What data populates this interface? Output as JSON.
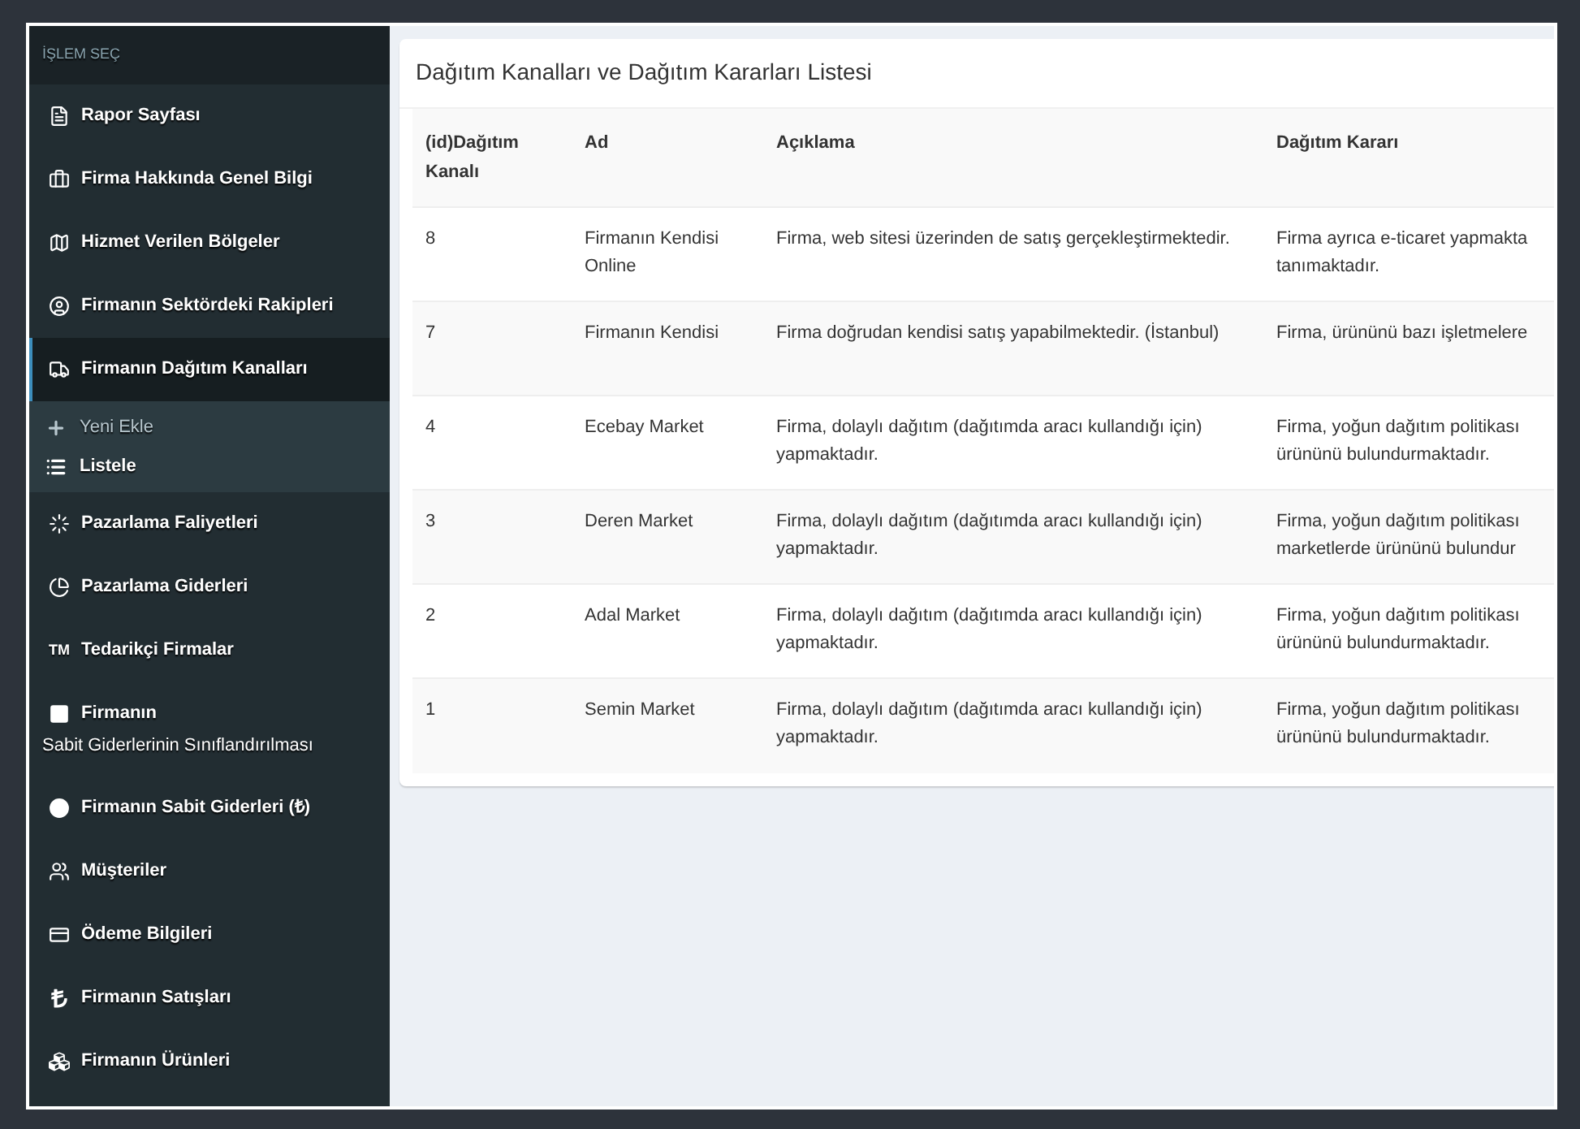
{
  "sidebar": {
    "header": "İŞLEM SEÇ",
    "items": [
      {
        "label": "Rapor Sayfası",
        "selected": false
      },
      {
        "label": "Firma Hakkında Genel Bilgi",
        "selected": false
      },
      {
        "label": "Hizmet Verilen Bölgeler",
        "selected": false
      },
      {
        "label": "Firmanın Sektördeki Rakipleri",
        "selected": false
      },
      {
        "label": "Firmanın Dağıtım Kanalları",
        "selected": true,
        "expanded": true,
        "children": [
          {
            "label": "Yeni Ekle",
            "selected": false
          },
          {
            "label": "Listele",
            "selected": true
          }
        ]
      },
      {
        "label": "Pazarlama Faliyetleri",
        "selected": false
      },
      {
        "label": "Pazarlama Giderleri",
        "selected": false
      },
      {
        "label": "Tedarikçi Firmalar",
        "icon_text": "TM",
        "selected": false
      },
      {
        "label": "Firmanın",
        "label_line_2": "Sabit Giderlerinin Sınıflandırılması",
        "selected": false
      },
      {
        "label": "Firmanın Sabit Giderleri (₺)",
        "selected": false
      },
      {
        "label": "Müşteriler",
        "selected": false
      },
      {
        "label": "Ödeme Bilgileri",
        "selected": false
      },
      {
        "label": "Firmanın Satışları",
        "selected": false
      },
      {
        "label": "Firmanın Ürünleri",
        "selected": false
      }
    ]
  },
  "card": {
    "title": "Dağıtım Kanalları ve Dağıtım Kararları Listesi",
    "table": {
      "columns": [
        "(id)Dağıtım Kanalı",
        "Ad",
        "Açıklama",
        "Dağıtım Kararı"
      ],
      "rows": [
        {
          "id": "8",
          "ad": "Firmanın Kendisi Online",
          "aciklama": "Firma, web sitesi üzerinden de satış gerçekleştirmektedir.",
          "karar": [
            "Firma ayrıca e-ticaret yapmakta",
            "tanımaktadır."
          ]
        },
        {
          "id": "7",
          "ad": "Firmanın Kendisi",
          "aciklama": "Firma doğrudan kendisi satış yapabilmektedir. (İstanbul)",
          "karar": [
            "Firma, ürününü bazı işletmelere"
          ]
        },
        {
          "id": "4",
          "ad": "Ecebay Market",
          "aciklama": "Firma, dolaylı dağıtım (dağıtımda aracı kullandığı için) yapmaktadır.",
          "karar": [
            "Firma, yoğun dağıtım politikası",
            "ürününü bulundurmaktadır."
          ]
        },
        {
          "id": "3",
          "ad": "Deren Market",
          "aciklama": "Firma, dolaylı dağıtım (dağıtımda aracı kullandığı için) yapmaktadır.",
          "karar": [
            "Firma, yoğun dağıtım politikası",
            "marketlerde ürününü bulundur"
          ]
        },
        {
          "id": "2",
          "ad": "Adal Market",
          "aciklama": "Firma, dolaylı dağıtım (dağıtımda aracı kullandığı için) yapmaktadır.",
          "karar": [
            "Firma, yoğun dağıtım politikası",
            "ürününü bulundurmaktadır."
          ]
        },
        {
          "id": "1",
          "ad": "Semin Market",
          "aciklama": "Firma, dolaylı dağıtım (dağıtımda aracı kullandığı için) yapmaktadır.",
          "karar": [
            "Firma, yoğun dağıtım politikası",
            "ürününü bulundurmaktadır."
          ]
        }
      ]
    }
  }
}
